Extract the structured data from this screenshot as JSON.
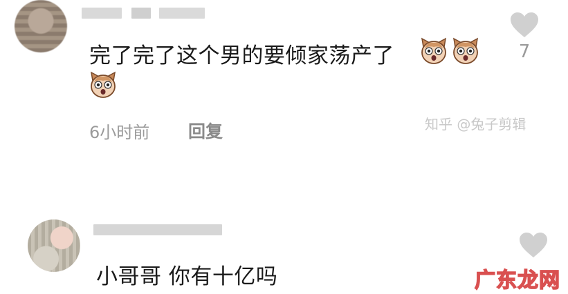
{
  "comments": [
    {
      "text": "完了完了这个男的要倾家荡产了",
      "emoji": "dog-face-emoji",
      "time": "6小时前",
      "reply_label": "回复",
      "likes": "7"
    },
    {
      "text": "小哥哥 你有十亿吗"
    }
  ],
  "watermarks": {
    "zhihu": "知乎 @兔子剪辑",
    "site": "广东龙网"
  },
  "icons": {
    "like": "heart-icon",
    "emoji": "dog-face-emoji"
  },
  "colors": {
    "like_heart": "#d0d0d0",
    "meta_text": "#9a9a9a",
    "site_watermark": "#d95050"
  }
}
